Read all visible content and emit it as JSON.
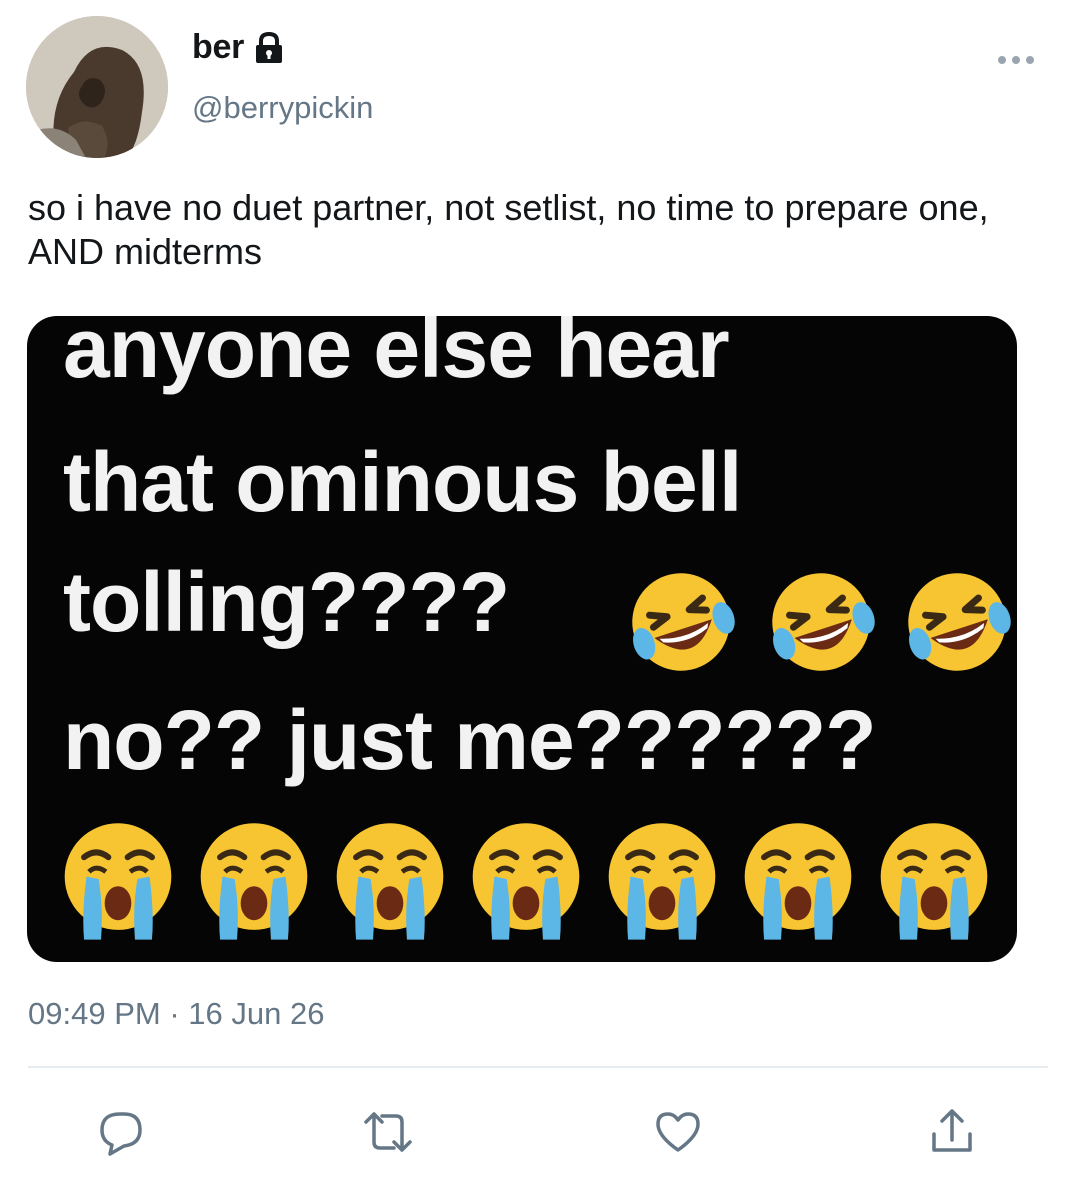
{
  "user": {
    "display_name": "ber",
    "handle": "@berrypickin",
    "protected_icon": "lock-icon",
    "avatar": "profile-photo"
  },
  "tweet": {
    "text": "so i have no duet partner, not setlist, no time to prepare one, AND midterms",
    "time": "09:49 PM",
    "separator": "·",
    "date": "16 Jun 26"
  },
  "media": {
    "lines": [
      "anyone else hear",
      "that ominous bell",
      "tolling????",
      "no?? just me??????"
    ],
    "emoji_row_1": [
      "rolling-laughing-emoji",
      "rolling-laughing-emoji",
      "rolling-laughing-emoji"
    ],
    "emoji_row_2": [
      "crying-emoji",
      "crying-emoji",
      "crying-emoji",
      "crying-emoji",
      "crying-emoji",
      "crying-emoji",
      "crying-emoji"
    ]
  },
  "actions": [
    "reply-icon",
    "retweet-icon",
    "like-icon",
    "share-icon"
  ],
  "colors": {
    "text": "#14171a",
    "secondary": "#657786",
    "accent": "#1da1f2",
    "divider": "#e6ecf0",
    "media_bg": "#050505"
  }
}
